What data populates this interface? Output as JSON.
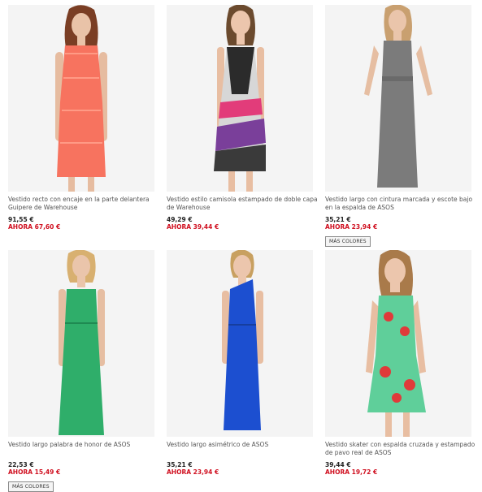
{
  "products": [
    {
      "title": "Vestido recto con encaje en la parte delantera Guipere de Warehouse",
      "price": "91,55 €",
      "sale": "AHORA 67,60 €",
      "colors_label": "",
      "dress_color": "#f7735f",
      "bg": "#f4f4f4"
    },
    {
      "title": "Vestido estilo camisola estampado de doble capa de Warehouse",
      "price": "49,29 €",
      "sale": "AHORA 39,44 €",
      "colors_label": "",
      "dress_color": "#4a4a4a",
      "bg": "#f4f4f4"
    },
    {
      "title": "Vestido largo con cintura marcada y escote bajo en la espalda de ASOS",
      "price": "35,21 €",
      "sale": "AHORA 23,94 €",
      "colors_label": "MÁS COLORES",
      "dress_color": "#7b7b7b",
      "bg": "#f4f4f4"
    },
    {
      "title": "Vestido largo palabra de honor de ASOS",
      "price": "22,53 €",
      "sale": "AHORA 15,49 €",
      "colors_label": "MÁS COLORES",
      "dress_color": "#2fae6a",
      "bg": "#f4f4f4"
    },
    {
      "title": "Vestido largo asimétrico de ASOS",
      "price": "35,21 €",
      "sale": "AHORA 23,94 €",
      "colors_label": "",
      "dress_color": "#1c4fd0",
      "bg": "#f4f4f4"
    },
    {
      "title": "Vestido skater con espalda cruzada y estampado de pavo real de ASOS",
      "price": "39,44 €",
      "sale": "AHORA 19,72 €",
      "colors_label": "",
      "dress_color": "#5fcf9a",
      "bg": "#f4f4f4"
    }
  ]
}
